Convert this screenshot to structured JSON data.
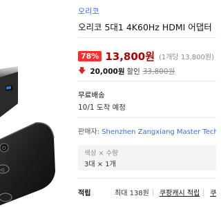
{
  "product": {
    "brand": "오리코",
    "title": "오리코 5대1 4K60Hz HDMI 어댑터"
  },
  "price": {
    "discount": "78%",
    "sale": "13,800원",
    "unit": "(1개당 13,800원)",
    "coupon_amount": "20,000원",
    "coupon_label": "할인",
    "original": "33,800원"
  },
  "shipping": {
    "label": "무료배송",
    "arrival": "10/1 도착 예정"
  },
  "seller": {
    "label": "판매자:",
    "name": "Shenzhen Zangxiang Master Technology"
  },
  "options": {
    "label": "색상 × 수량",
    "value": "3대 × 1개"
  },
  "reward": {
    "label": "적립",
    "max": "최대 138원",
    "link1": "쿠팡캐시 적립",
    "link2": "쿠"
  },
  "colors": {
    "brand_blue": "#346aff",
    "discount_red": "#ff2d2d",
    "price_red": "#ae0000"
  },
  "icons": [
    "red-down-arrow-icon"
  ]
}
